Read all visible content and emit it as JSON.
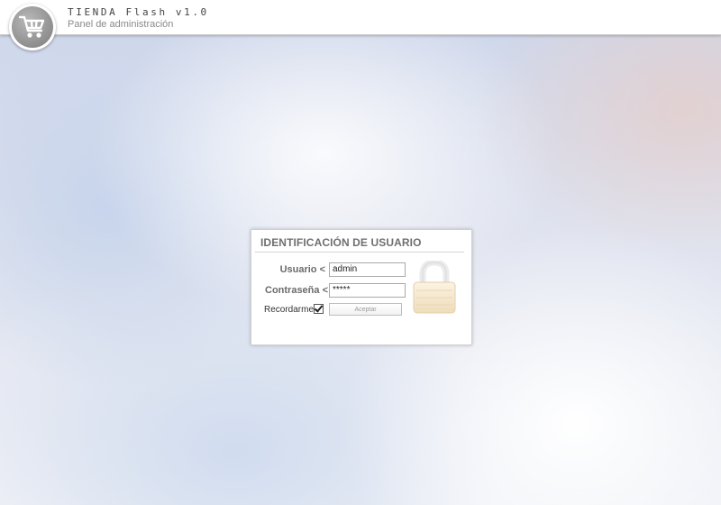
{
  "header": {
    "app_title": "TIENDA Flash v1.0",
    "app_subtitle": "Panel de administración",
    "logo_icon": "shopping-cart-icon"
  },
  "login": {
    "title": "IDENTIFICACIÓN DE USUARIO",
    "username_label": "Usuario <",
    "username_value": "admin",
    "password_label": "Contraseña <",
    "password_value": "*****",
    "remember_label": "Recordarme",
    "remember_checked": true,
    "submit_label": "Aceptar",
    "lock_icon": "padlock-icon"
  },
  "colors": {
    "header_bg": "#ffffff",
    "panel_bg": "#ffffff",
    "title_text": "#6f6f6f",
    "lock_tint": "#f4e7cf"
  }
}
